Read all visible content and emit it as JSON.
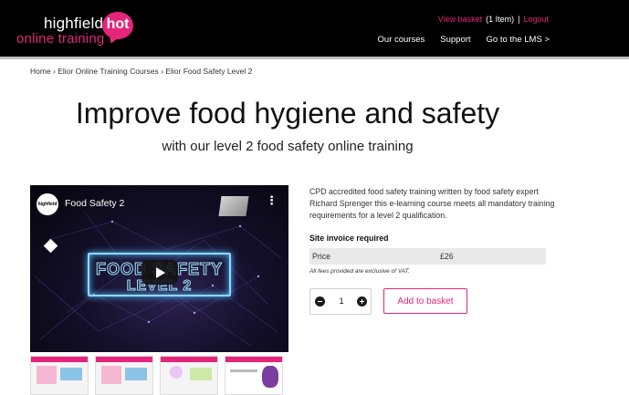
{
  "header": {
    "logo": {
      "line1": "highfield",
      "line2": "online training",
      "badge": "hot"
    },
    "top_links": {
      "view_basket": "View basket",
      "items": "(1 Item)",
      "separator": "|",
      "logout": "Logout"
    },
    "nav": [
      "Our courses",
      "Support",
      "Go to the LMS >"
    ]
  },
  "breadcrumb": "Home › Elior Online Training Courses › Elior Food Safety Level 2",
  "hero": {
    "title": "Improve food hygiene and safety",
    "subtitle": "with our level 2 food safety online training"
  },
  "video": {
    "channel_avatar": "highfield",
    "title": "Food Safety 2",
    "sign_line1": "FOOD SAFETY",
    "sign_line2": "LEVEL 2",
    "icons": {
      "menu": "more-vertical-icon",
      "play": "play-icon"
    }
  },
  "product": {
    "description": "CPD accredited food safety training written by food safety expert Richard Sprenger this e-learning course meets all mandatory training requirements for a level 2 qualification.",
    "site_invoice": "Site invoice required",
    "price_label": "Price",
    "price_value": "£26",
    "fees_note": "All fees provided are exclusive of VAT.",
    "quantity": "1",
    "add_to_basket": "Add to basket"
  },
  "colors": {
    "brand_pink": "#e5257a",
    "header_bg": "#000000"
  }
}
